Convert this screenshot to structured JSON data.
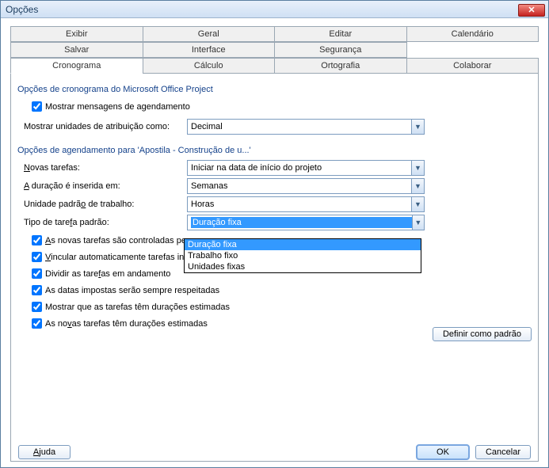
{
  "window": {
    "title": "Opções"
  },
  "tabs": {
    "row1": [
      "Exibir",
      "Geral",
      "Editar",
      "Calendário"
    ],
    "row2": [
      "Salvar",
      "Interface",
      "Segurança",
      ""
    ],
    "row3": [
      "Cronograma",
      "Cálculo",
      "Ortografia",
      "Colaborar"
    ],
    "active": "Cronograma"
  },
  "section1": {
    "title": "Opções de cronograma do Microsoft Office Project",
    "show_sched_msgs": "Mostrar mensagens de agendamento",
    "show_units_label": "Mostrar unidades de atribuição como:",
    "show_units_value": "Decimal"
  },
  "section2": {
    "title": "Opções de agendamento para 'Apostila - Construção de u...'",
    "new_tasks_label": "Novas tarefas:",
    "new_tasks_value": "Iniciar na data de início do projeto",
    "duration_in_label": "A duração é inserida em:",
    "duration_in_value": "Semanas",
    "work_unit_label": "Unidade padrão de trabalho:",
    "work_unit_value": "Horas",
    "task_type_label": "Tipo de tarefa padrão:",
    "task_type_value": "Duração fixa",
    "task_type_options": [
      "Duração fixa",
      "Trabalho fixo",
      "Unidades fixas"
    ],
    "chk_effort": "As novas tarefas são controladas pe",
    "chk_autolink": "Vincular automaticamente tarefas in",
    "chk_split": "Dividir as tarefas em andamento",
    "chk_constraints": "As datas impostas serão sempre respeitadas",
    "chk_show_est": "Mostrar que as tarefas têm durações estimadas",
    "chk_new_est": "As novas tarefas têm durações estimadas",
    "set_default_btn": "Definir como padrão"
  },
  "buttons": {
    "help": "Ajuda",
    "ok": "OK",
    "cancel": "Cancelar"
  }
}
